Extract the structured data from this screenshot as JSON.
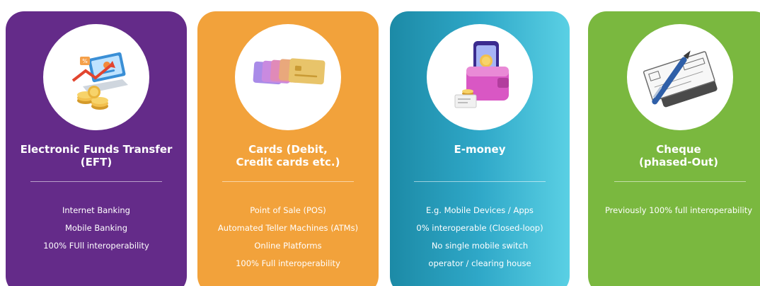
{
  "cards": [
    {
      "id": "eft",
      "color": "#642b89",
      "icon": "laptop-payment-icon",
      "title": "Electronic Funds Transfer\n(EFT)",
      "items": [
        "Internet Banking",
        "Mobile Banking",
        "100% FUll interoperability"
      ]
    },
    {
      "id": "cards",
      "color": "#f2a23b",
      "icon": "credit-cards-icon",
      "title": "Cards (Debit,\nCredit cards etc.)",
      "items": [
        "Point of Sale (POS)",
        "Automated Teller Machines (ATMs)",
        "Online Platforms",
        "100% Full interoperability"
      ]
    },
    {
      "id": "emoney",
      "color": "#2fa8c8",
      "icon": "mobile-wallet-icon",
      "title": "E-money",
      "items": [
        "E.g. Mobile Devices / Apps",
        "0% interoperable (Closed-loop)",
        "No single mobile switch",
        "operator / clearing house"
      ]
    },
    {
      "id": "cheque",
      "color": "#7ab83f",
      "icon": "cheque-pen-icon",
      "title": "Cheque\n(phased-Out)",
      "items": [
        "Previously 100% full interoperability"
      ]
    }
  ]
}
